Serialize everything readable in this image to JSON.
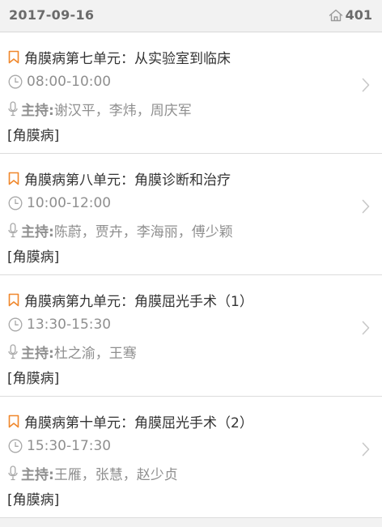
{
  "header": {
    "date": "2017-09-16",
    "room": "401",
    "room_icon": "home-icon"
  },
  "sessions": [
    {
      "title": "角膜病第七单元：从实验室到临床",
      "time": "08:00-10:00",
      "host_label": "主持:",
      "hosts": "谢汉平，李炜，周庆军",
      "tag": "[角膜病]"
    },
    {
      "title": "角膜病第八单元：角膜诊断和治疗",
      "time": "10:00-12:00",
      "host_label": "主持:",
      "hosts": "陈蔚，贾卉，李海丽，傅少颖",
      "tag": "[角膜病]"
    },
    {
      "title": "角膜病第九单元：角膜屈光手术（1）",
      "time": "13:30-15:30",
      "host_label": "主持:",
      "hosts": "杜之渝，王骞",
      "tag": "[角膜病]"
    },
    {
      "title": "角膜病第十单元：角膜屈光手术（2）",
      "time": "15:30-17:30",
      "host_label": "主持:",
      "hosts": "王雁，张慧，赵少贞",
      "tag": "[角膜病]"
    }
  ],
  "colors": {
    "accent": "#f0872b",
    "icon_gray": "#9a9a9a",
    "text_dark": "#333333",
    "text_gray": "#8f8f8f"
  }
}
